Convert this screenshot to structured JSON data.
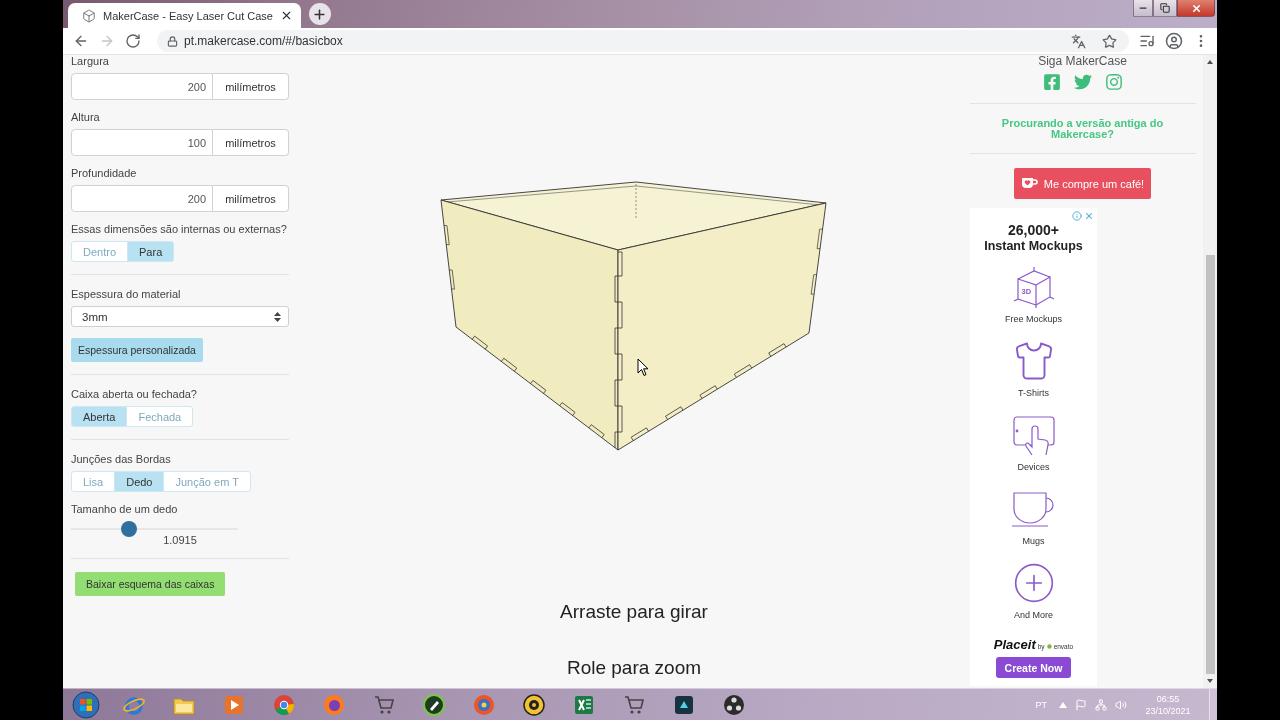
{
  "browser": {
    "tab_title": "MakerCase - Easy Laser Cut Case",
    "nav": [
      {
        "kind": "back",
        "disabled": false
      },
      {
        "kind": "forward",
        "disabled": true
      },
      {
        "kind": "reload",
        "disabled": false
      }
    ],
    "url": "pt.makercase.com/#/basicbox"
  },
  "sidebar": {
    "sections": [
      {
        "items": [
          {
            "kind": "dimension",
            "label": "Largura",
            "value": "200",
            "unit": "milímetros"
          },
          {
            "kind": "dimension",
            "label": "Altura",
            "value": "100",
            "unit": "milímetros"
          },
          {
            "kind": "dimension",
            "label": "Profundidade",
            "value": "200",
            "unit": "milímetros"
          },
          {
            "kind": "toggle",
            "label": "Essas dimensões são internas ou externas?",
            "options": [
              {
                "label": "Dentro",
                "selected": false
              },
              {
                "label": "Para",
                "selected": true
              }
            ]
          }
        ]
      },
      {
        "items": [
          {
            "kind": "select",
            "label": "Espessura do material",
            "value": "3mm"
          },
          {
            "kind": "button",
            "label": "Espessura personalizada"
          }
        ]
      },
      {
        "items": [
          {
            "kind": "toggle",
            "label": "Caixa aberta ou fechada?",
            "options": [
              {
                "label": "Aberta",
                "selected": true
              },
              {
                "label": "Fechada",
                "selected": false
              }
            ]
          }
        ]
      },
      {
        "items": [
          {
            "kind": "toggle",
            "label": "Junções das Bordas",
            "options": [
              {
                "label": "Lisa",
                "selected": false
              },
              {
                "label": "Dedo",
                "selected": true
              },
              {
                "label": "Junção em T",
                "selected": false
              }
            ]
          },
          {
            "kind": "slider",
            "label": "Tamanho de um dedo",
            "level": 0.35,
            "reading": "1.0915"
          }
        ]
      },
      {
        "items": [
          {
            "kind": "action",
            "label": "Baixar esquema das caixas"
          }
        ]
      }
    ]
  },
  "viewer": {
    "hints": [
      "Arraste para girar",
      "Role para zoom"
    ]
  },
  "right_panel": {
    "follow_title": "Siga MakerCase",
    "old_version_link": "Procurando a versão antiga do Makercase?",
    "coffee_button": "Me compre um café!",
    "ad": {
      "headline": "26,000+",
      "subheadline": "Instant Mockups",
      "items": [
        {
          "kind": "cube",
          "label": "Free Mockups",
          "icon_text": "3D"
        },
        {
          "kind": "shirt",
          "label": "T-Shirts"
        },
        {
          "kind": "tablet",
          "label": "Devices"
        },
        {
          "kind": "mug",
          "label": "Mugs"
        },
        {
          "kind": "plus",
          "label": "And More"
        }
      ],
      "brand": "Placeit",
      "brand_by": "by",
      "brand_owner": "envato",
      "button": "Create Now"
    }
  },
  "taskbar": {
    "language": "PT",
    "time": "06:55",
    "date": "23/10/2021"
  }
}
